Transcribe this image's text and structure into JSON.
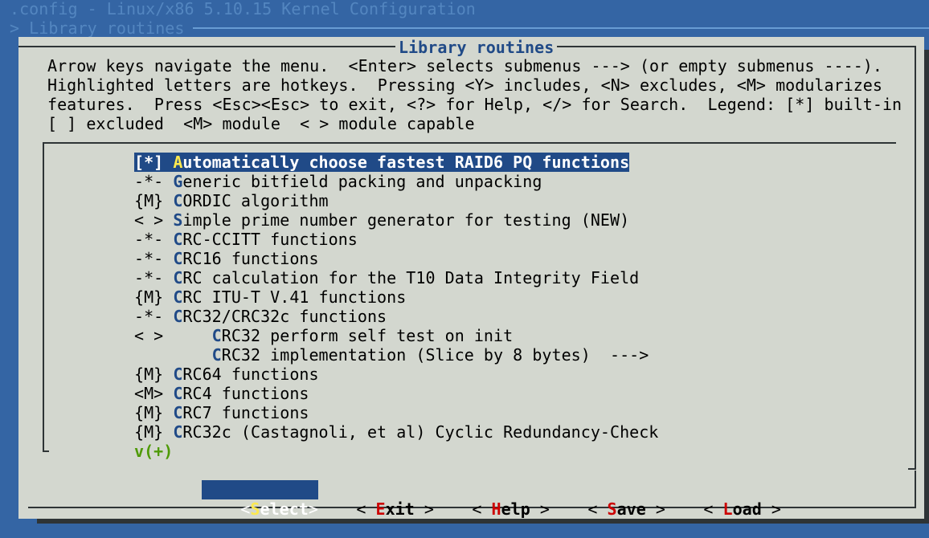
{
  "header": {
    "title": ".config - Linux/x86 5.10.15 Kernel Configuration",
    "breadcrumb": "> Library routines"
  },
  "dialog": {
    "title": "Library routines",
    "help_lines": [
      "Arrow keys navigate the menu.  <Enter> selects submenus ---> (or empty submenus ----).",
      "Highlighted letters are hotkeys.  Pressing <Y> includes, <N> excludes, <M> modularizes",
      "features.  Press <Esc><Esc> to exit, <?> for Help, </> for Search.  Legend: [*] built-in",
      "[ ] excluded  <M> module  < > module capable"
    ]
  },
  "menu": {
    "items": [
      {
        "state": "[*] ",
        "hotkey": "A",
        "rest": "utomatically choose fastest RAID6 PQ functions",
        "selected": true
      },
      {
        "state": "-*- ",
        "hotkey": "G",
        "rest": "eneric bitfield packing and unpacking"
      },
      {
        "state": "{M} ",
        "hotkey": "C",
        "rest": "ORDIC algorithm"
      },
      {
        "state": "< > ",
        "hotkey": "S",
        "rest": "imple prime number generator for testing (NEW)"
      },
      {
        "state": "-*- ",
        "hotkey": "C",
        "rest": "RC-CCITT functions"
      },
      {
        "state": "-*- ",
        "hotkey": "C",
        "rest": "RC16 functions"
      },
      {
        "state": "-*- ",
        "hotkey": "C",
        "rest": "RC calculation for the T10 Data Integrity Field"
      },
      {
        "state": "{M} ",
        "hotkey": "C",
        "rest": "RC ITU-T V.41 functions"
      },
      {
        "state": "-*- ",
        "hotkey": "C",
        "rest": "RC32/CRC32c functions"
      },
      {
        "state": "< >     ",
        "hotkey": "C",
        "rest": "RC32 perform self test on init"
      },
      {
        "state": "        ",
        "hotkey": "C",
        "rest": "RC32 implementation (Slice by 8 bytes)  --->"
      },
      {
        "state": "{M} ",
        "hotkey": "C",
        "rest": "RC64 functions"
      },
      {
        "state": "<M> ",
        "hotkey": "C",
        "rest": "RC4 functions"
      },
      {
        "state": "{M} ",
        "hotkey": "C",
        "rest": "RC7 functions"
      },
      {
        "state": "{M} ",
        "hotkey": "C",
        "rest": "RC32c (Castagnoli, et al) Cyclic Redundancy-Check"
      }
    ],
    "more_indicator": "v(+)"
  },
  "buttons": {
    "select": {
      "open": "<",
      "key": "S",
      "rest": "elect",
      "close": ">"
    },
    "exit": {
      "open": "< ",
      "key": "E",
      "rest": "xit",
      "close": " >"
    },
    "help": {
      "open": "< ",
      "key": "H",
      "rest": "elp",
      "close": " >"
    },
    "save": {
      "open": "< ",
      "key": "S",
      "rest": "ave",
      "close": " >"
    },
    "load": {
      "open": "< ",
      "key": "L",
      "rest": "oad",
      "close": " >"
    }
  },
  "colors": {
    "background": "#3465a4",
    "dialog": "#d3d7cf",
    "highlight": "#204a87",
    "hotkey_button": "#cc0000",
    "hotkey_selected": "#fce94f",
    "more_indicator": "#4e9a06"
  }
}
